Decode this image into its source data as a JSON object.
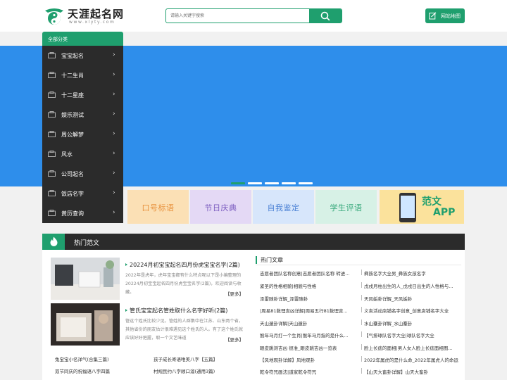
{
  "header": {
    "logo_title": "天涯起名网",
    "logo_sub": "www.xlyty.com",
    "search_placeholder": "请输入关键字搜索",
    "sitemap_label": "网站地图"
  },
  "sidebar": {
    "heading": "全部分类",
    "items": [
      {
        "label": "宝宝起名"
      },
      {
        "label": "十二生肖"
      },
      {
        "label": "十二星座"
      },
      {
        "label": "娱乐测试"
      },
      {
        "label": "周公解梦"
      },
      {
        "label": "风水"
      },
      {
        "label": "公司起名"
      },
      {
        "label": "饭店名字"
      },
      {
        "label": "黄历查询"
      }
    ]
  },
  "tiles": [
    {
      "label": "口号标语",
      "bg": "#fbe0b5",
      "fg": "#e8913c"
    },
    {
      "label": "节日庆典",
      "bg": "#e4d9f5",
      "fg": "#7a5bbf"
    },
    {
      "label": "自我鉴定",
      "bg": "#d7e6fb",
      "fg": "#4f84d6"
    },
    {
      "label": "学生评语",
      "bg": "#d7f1e6",
      "fg": "#36a87a"
    }
  ],
  "app_tile": {
    "line1": "范文",
    "line2": "APP"
  },
  "hot": {
    "title": "热门范文",
    "articles": [
      {
        "title": "20224月初宝宝起名四月份虎宝宝名字(2篇)",
        "desc": "2022年是虎年，虎年宝宝都有什么特点呢以下是小编整理的20224月初宝宝起名四月份虎宝宝名字(2篇)，欢迎阅读与收藏。",
        "more": "【更多】"
      },
      {
        "title": "管氏宝宝起名管姓取什么名字好听(2篇)",
        "desc": "管这个姓氏比较少见，管姓的人群集中在江苏、山东两个省，其他省份的朋友估计很难遇见这个姓氏的人。有了这个姓氏就应该好好把握，取一个文艺味道",
        "more": "【更多】"
      }
    ],
    "bottom_links": [
      "兔宝宝小名洋气(合集三篇)",
      "孩子成长寄语唯美八字【五篇】",
      "双节同庆的祝福语八字四篇",
      "村规民约八字顺口溜(通用3篇)"
    ],
    "hot_articles_title": "热门文章",
    "hot_articles": [
      [
        "志愿者团队名称创意|志愿者团队名称 转进...",
        "彝族名字大全男_彝族女孩名字"
      ],
      [
        "紧圣的性格相貌|相貌与性格",
        "戊戌月柱出生的人_戊戌日出生的人性格与..."
      ],
      [
        "泽雷随卦详解_泽雷随卦",
        "天风姤卦详解_天风姤卦"
      ],
      [
        "|周易81数理吉凶详解|周易五行81数理吉...",
        "义卖活动店铺名字创意_创意店铺名字大全"
      ],
      [
        "天山遁卦详解|天山遁卦",
        "水山蹇卦详解_水山蹇卦"
      ],
      [
        "猴年马月打一个生肖|猴年马月指的是什么...",
        "【气排球队名字大全|球队名字大全"
      ],
      [
        "眼皮跳测吉凶 很准_眼皮跳吉凶一览表",
        "脸上长痣的面相|男人女人脸上长痣面相图..."
      ],
      [
        "【风地观卦详解】风地观卦",
        "2022年属虎的是什么命_2022年属虎人的命运"
      ],
      [
        "乾令符咒画法|道家乾令符咒",
        "【山天大畜卦详解】山天大畜卦"
      ]
    ]
  },
  "colors": {
    "brand": "#1f9f6e",
    "banner": "#2e8eeb",
    "dark": "#2b2b2b"
  }
}
